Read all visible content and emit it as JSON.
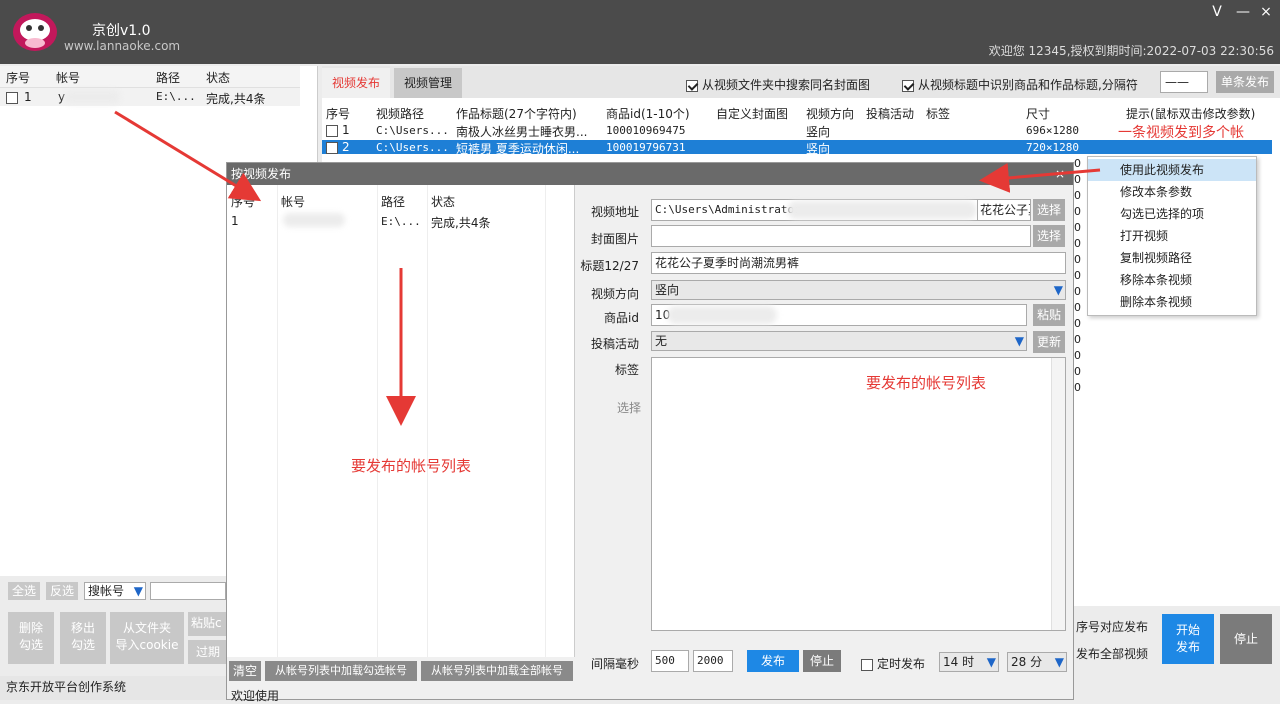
{
  "app": {
    "name": "京创v1.0",
    "url": "www.lannaoke.com",
    "welcome": "欢迎您 12345,授权到期时间:2022-07-03 22:30:56",
    "minimize": "V",
    "close": "×"
  },
  "left": {
    "headers": [
      "序号",
      "帐号",
      "路径",
      "状态"
    ],
    "rows": [
      {
        "no": "1",
        "acct": "y",
        "path": "E:\\...",
        "status": "完成,共4条"
      }
    ],
    "select_all": "全选",
    "invert": "反选",
    "search_mode": "搜帐号",
    "actions": {
      "delete": "删除\n勾选",
      "move": "移出\n勾选",
      "import": "从文件夹\n导入cookie",
      "paste": "粘贴c",
      "expire": "过期"
    }
  },
  "tabs": {
    "publish": "视频发布",
    "manage": "视频管理"
  },
  "options": {
    "search_cover": "从视频文件夹中搜索同名封面图",
    "recognize": "从视频标题中识别商品和作品标题,分隔符",
    "separator": "——",
    "single": "单条发布"
  },
  "grid": {
    "headers": [
      "序号",
      "视频路径",
      "作品标题(27个字符内)",
      "商品id(1-10个)",
      "自定义封面图",
      "视频方向",
      "投稿活动",
      "标签",
      "尺寸",
      "提示(鼠标双击修改参数)"
    ],
    "rows": [
      {
        "no": "1",
        "path": "C:\\Users...",
        "title": "南极人冰丝男士睡衣男...",
        "pid": "100010969475",
        "dir": "竖向",
        "size": "696×1280"
      },
      {
        "no": "2",
        "path": "C:\\Users...",
        "title": "短裤男 夏季运动休闲...",
        "pid": "100019796731",
        "dir": "竖向",
        "size": "720×1280"
      }
    ],
    "annotation": "一条视频发到多个帐",
    "zeros": [
      "0",
      "0",
      "0",
      "0",
      "0",
      "0",
      "0",
      "0",
      "0",
      "0",
      "0",
      "0",
      "0",
      "0",
      "0"
    ]
  },
  "menu": [
    "使用此视频发布",
    "修改本条参数",
    "勾选已选择的项",
    "打开视频",
    "复制视频路径",
    "移除本条视频",
    "删除本条视频"
  ],
  "dialog": {
    "title": "按视频发布",
    "close": "×",
    "headers": [
      "序号",
      "帐号",
      "路径",
      "状态"
    ],
    "row": {
      "no": "1",
      "path": "E:\\...",
      "status": "完成,共4条"
    },
    "annotation_left": "要发布的帐号列表",
    "annotation_right": "要发布的帐号列表",
    "labels": {
      "video": "视频地址",
      "cover": "封面图片",
      "title": "标题12/27",
      "dir": "视频方向",
      "pid": "商品id",
      "activity": "投稿活动",
      "tags": "标签",
      "select": "选择",
      "interval": "间隔毫秒"
    },
    "values": {
      "video": "C:\\Users\\Administrator",
      "video_tail": "花花公子夏",
      "title": "花花公子夏季时尚潮流男裤",
      "dir": "竖向",
      "pid": "10",
      "activity": "无",
      "min": "500",
      "max": "2000",
      "hour": "14 时",
      "minute": "28 分"
    },
    "buttons": {
      "pick1": "选择",
      "pick2": "选择",
      "paste": "粘贴",
      "refresh": "更新",
      "publish": "发布",
      "stop": "停止",
      "clear": "清空",
      "load_checked": "从帐号列表中加载勾选帐号",
      "load_all": "从帐号列表中加载全部帐号"
    },
    "timed": "定时发布",
    "status": "欢迎使用"
  },
  "bottom_right": {
    "seq": "序号对应发布",
    "all": "发布全部视频",
    "start": "开始\n发布",
    "stop": "停止"
  },
  "statusbar": "京东开放平台创作系统"
}
